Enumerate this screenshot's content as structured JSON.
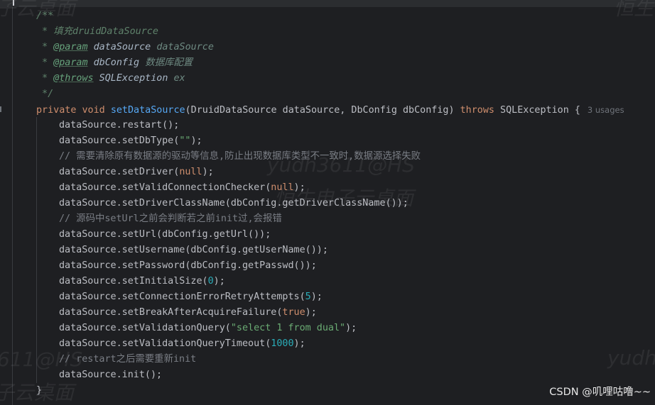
{
  "code": {
    "doc_open": "/**",
    "doc_line1": " * 填充druidDataSource",
    "doc_param1_star": " * ",
    "doc_param1_tag": "@param",
    "doc_param1_name": " dataSource ",
    "doc_param1_ref": "dataSource",
    "doc_param2_star": " * ",
    "doc_param2_tag": "@param",
    "doc_param2_name": " dbConfig ",
    "doc_param2_desc": "数据库配置",
    "doc_throws_star": " * ",
    "doc_throws_tag": "@throws",
    "doc_throws_name": " SQLException ",
    "doc_throws_ref": "ex",
    "doc_close": " */",
    "sig_private": "private ",
    "sig_void": "void ",
    "sig_name": "setDataSource",
    "sig_params": "(DruidDataSource dataSource, DbConfig dbConfig) ",
    "sig_throws": "throws",
    "sig_rest": " SQLException {",
    "usages": "3 usages",
    "l1": "dataSource.restart();",
    "l2_a": "dataSource.setDbType(",
    "l2_str": "\"\"",
    "l2_b": ");",
    "c1": "// 需要清除原有数据源的驱动等信息,防止出现数据库类型不一致时,数据源选择失败",
    "l3_a": "dataSource.setDriver(",
    "l3_kw": "null",
    "l3_b": ");",
    "l4_a": "dataSource.setValidConnectionChecker(",
    "l4_kw": "null",
    "l4_b": ");",
    "l5": "dataSource.setDriverClassName(dbConfig.getDriverClassName());",
    "c2": "// 源码中setUrl之前会判断若之前init过,会报错",
    "l6": "dataSource.setUrl(dbConfig.getUrl());",
    "l7": "dataSource.setUsername(dbConfig.getUserName());",
    "l8": "dataSource.setPassword(dbConfig.getPasswd());",
    "l9_a": "dataSource.setInitialSize(",
    "l9_num": "0",
    "l9_b": ");",
    "l10_a": "dataSource.setConnectionErrorRetryAttempts(",
    "l10_num": "5",
    "l10_b": ");",
    "l11_a": "dataSource.setBreakAfterAcquireFailure(",
    "l11_kw": "true",
    "l11_b": ");",
    "l12_a": "dataSource.setValidationQuery(",
    "l12_str": "\"select 1 from dual\"",
    "l12_b": ");",
    "l13_a": "dataSource.setValidationQueryTimeout(",
    "l13_num": "1000",
    "l13_b": ");",
    "c3": "// restart之后需要重新init",
    "l14": "dataSource.init();",
    "close_brace": "}"
  },
  "watermarks": {
    "w1": "子云桌面",
    "w2": "恒生",
    "w3": "yudh3611@HS",
    "w4": "恒生电子云桌面",
    "w5": "611@HS",
    "w6": "子云桌面",
    "w7": "yudh"
  },
  "credit": "CSDN @叽哩咕噜~~",
  "colors": {
    "background": "#1e1f22",
    "keyword": "#cf8e6d",
    "function": "#56a8f5",
    "string": "#6aab73",
    "number": "#2aacb8",
    "comment": "#7a7e85",
    "doc_comment": "#5f826b"
  }
}
